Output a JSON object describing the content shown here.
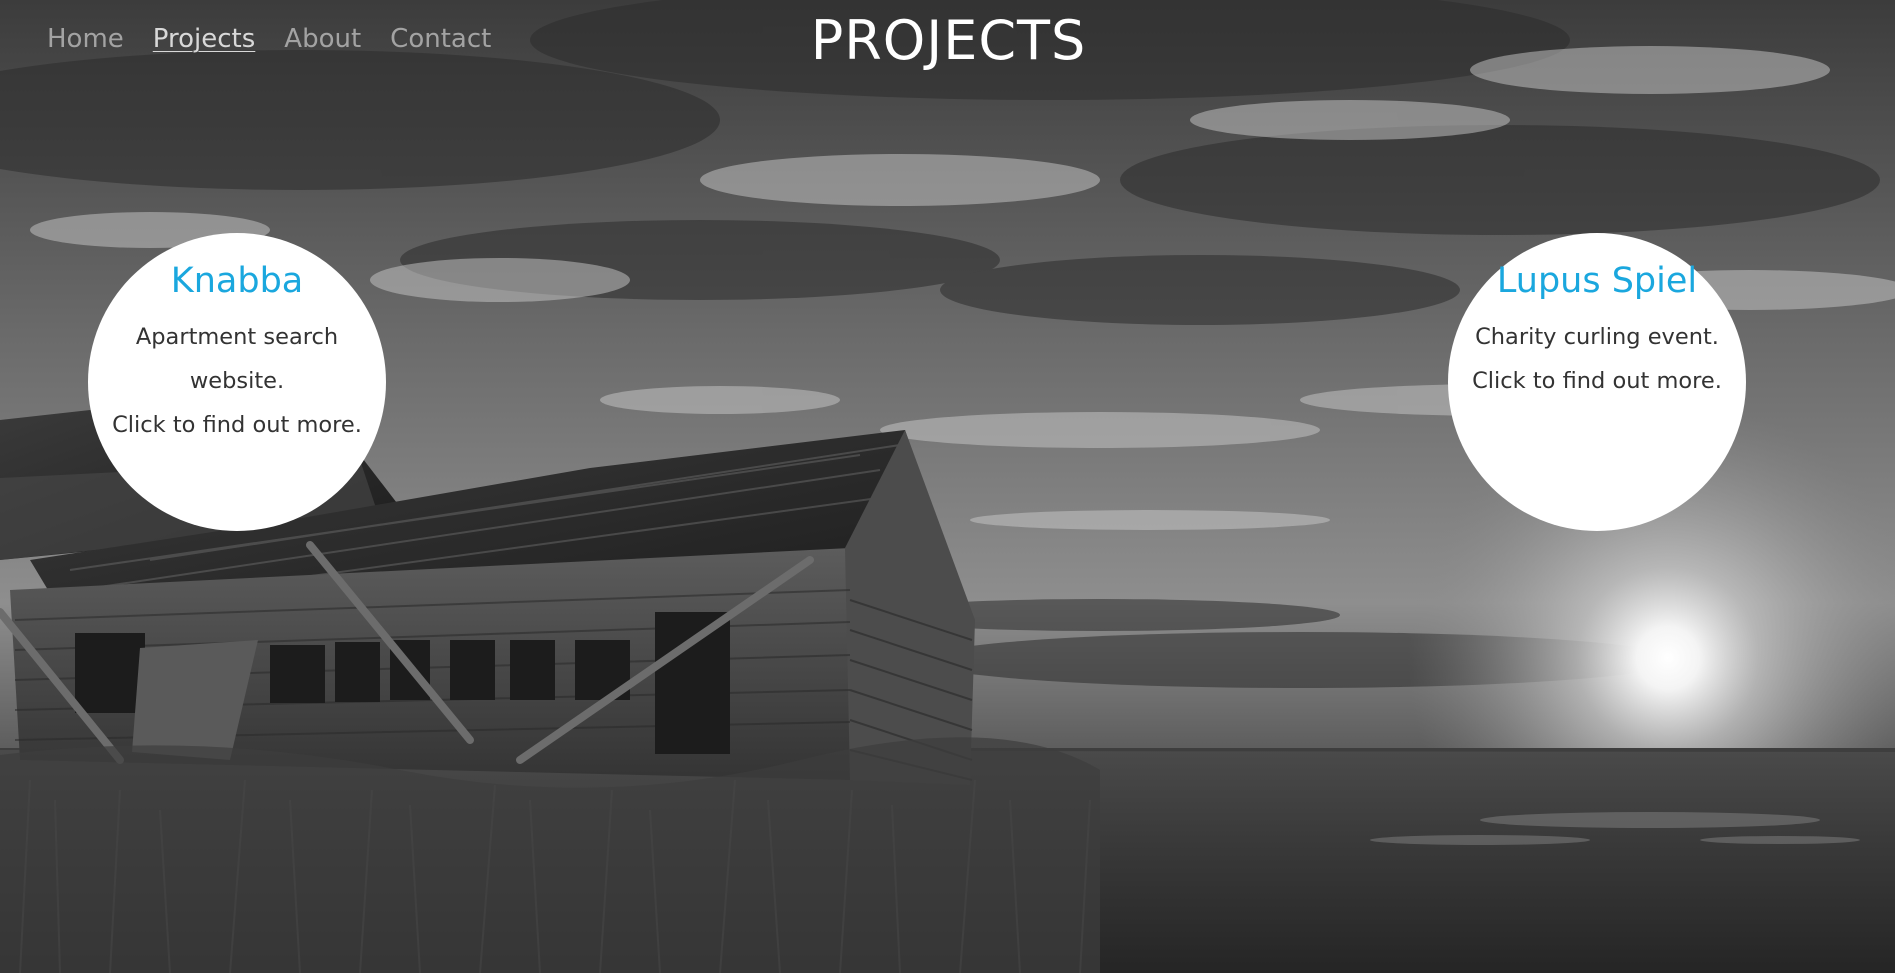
{
  "nav": {
    "items": [
      {
        "label": "Home",
        "active": false
      },
      {
        "label": "Projects",
        "active": true
      },
      {
        "label": "About",
        "active": false
      },
      {
        "label": "Contact",
        "active": false
      }
    ]
  },
  "page": {
    "title": "PROJECTS"
  },
  "projects": [
    {
      "name": "Knabba",
      "description": "Apartment search website.",
      "cta": "Click to find out more."
    },
    {
      "name": "Lupus Spiel",
      "description": "Charity curling event.",
      "cta": "Click to find out more."
    }
  ],
  "colors": {
    "project_title": "#1aa7de",
    "project_text": "#333333",
    "circle_bg": "#ffffff",
    "nav_text": "#a3a3a3",
    "heading": "#ffffff"
  },
  "background": {
    "description_icon": "grayscale-landscape-photo"
  }
}
